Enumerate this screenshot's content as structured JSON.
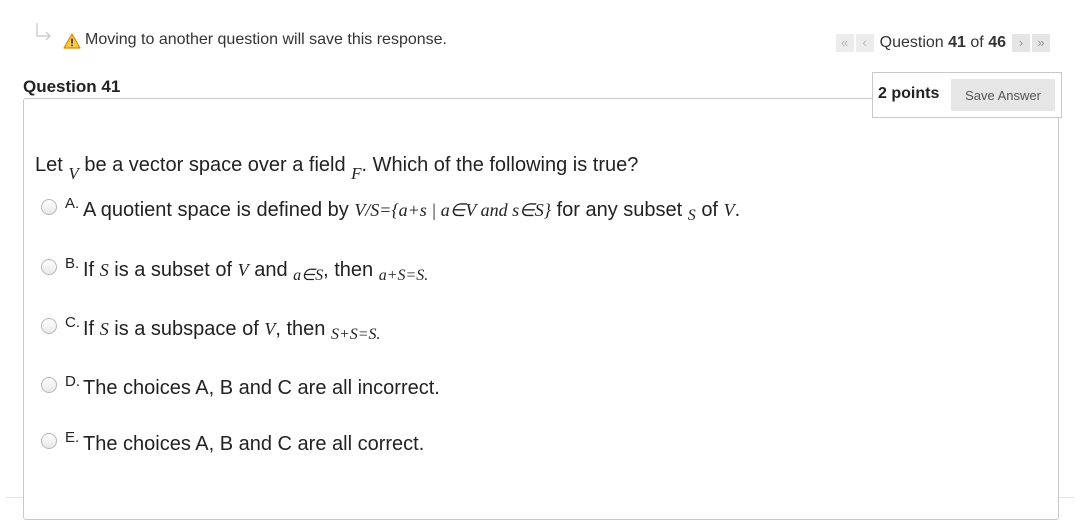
{
  "header": {
    "warning_text": "Moving to another question will save this response.",
    "question_prefix": "Question",
    "question_current": "41",
    "question_of": "of",
    "question_total": "46",
    "first_label": "«",
    "prev_label": "‹",
    "next_label": "›",
    "last_label": "»"
  },
  "question": {
    "title": "Question 41",
    "points": "2 points",
    "save_label": "Save Answer",
    "stem": {
      "t1": "Let",
      "v": "V",
      "t2": "be a vector space over a field",
      "f": "F",
      "t3": ". Which of the following is true?"
    },
    "choices": [
      {
        "letter": "A.",
        "t1": "A quotient space is defined by",
        "math1": "V/S={a+s | a∈V and s∈S}",
        "t2": "for any subset",
        "math2": "S",
        "t3": "of",
        "math3": "V",
        "t4": "."
      },
      {
        "letter": "B.",
        "t1": "If",
        "math1": "S",
        "t2": "is a subset of",
        "math2": "V",
        "t3": "and",
        "math3": "a∈S",
        "t4": ", then",
        "math4": "a+S=S",
        "t5": "."
      },
      {
        "letter": "C.",
        "t1": "If",
        "math1": "S",
        "t2": "is a subspace of",
        "math2": "V",
        "t3": ", then",
        "math3": "S+S=S",
        "t4": "."
      },
      {
        "letter": "D.",
        "text": "The choices A, B and C are all incorrect."
      },
      {
        "letter": "E.",
        "text": "The choices A, B and C are all correct."
      }
    ]
  }
}
